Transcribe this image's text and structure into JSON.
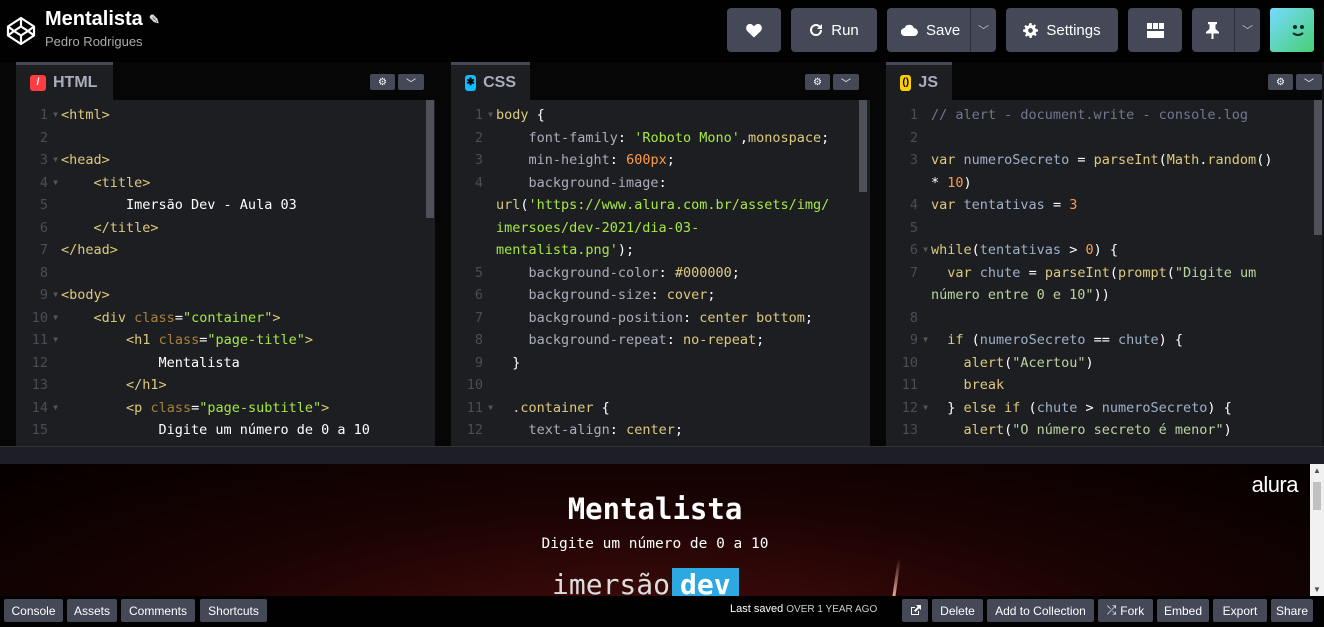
{
  "header": {
    "pen_title": "Mentalista",
    "author": "Pedro Rodrigues",
    "buttons": {
      "love": "",
      "run": "Run",
      "save": "Save",
      "settings": "Settings"
    }
  },
  "panes": {
    "html": {
      "label": "HTML",
      "icon_color": "#ff3c41",
      "lines": [
        {
          "n": "1",
          "fold": true,
          "html": "<span class='t'>&lt;html&gt;</span>"
        },
        {
          "n": "2",
          "fold": false,
          "html": ""
        },
        {
          "n": "3",
          "fold": true,
          "html": "<span class='t'>&lt;head&gt;</span>"
        },
        {
          "n": "4",
          "fold": true,
          "html": "    <span class='t'>&lt;title&gt;</span>"
        },
        {
          "n": "5",
          "fold": false,
          "html": "        Imersão Dev - Aula 03"
        },
        {
          "n": "6",
          "fold": false,
          "html": "    <span class='t'>&lt;/title&gt;</span>"
        },
        {
          "n": "7",
          "fold": false,
          "html": "<span class='t'>&lt;/head&gt;</span>"
        },
        {
          "n": "8",
          "fold": false,
          "html": ""
        },
        {
          "n": "9",
          "fold": true,
          "html": "<span class='t'>&lt;body&gt;</span>"
        },
        {
          "n": "10",
          "fold": true,
          "html": "    <span class='t'>&lt;div</span> <span class='a'>class</span>=<span class='str2'>\"container\"</span><span class='t'>&gt;</span>"
        },
        {
          "n": "11",
          "fold": true,
          "html": "        <span class='t'>&lt;h1</span> <span class='a'>class</span>=<span class='str2'>\"page-title\"</span><span class='t'>&gt;</span>"
        },
        {
          "n": "12",
          "fold": false,
          "html": "            Mentalista"
        },
        {
          "n": "13",
          "fold": false,
          "html": "        <span class='t'>&lt;/h1&gt;</span>"
        },
        {
          "n": "14",
          "fold": true,
          "html": "        <span class='t'>&lt;p</span> <span class='a'>class</span>=<span class='str2'>\"page-subtitle\"</span><span class='t'>&gt;</span>"
        },
        {
          "n": "15",
          "fold": false,
          "html": "            Digite um número de 0 a 10"
        }
      ]
    },
    "css": {
      "label": "CSS",
      "icon_color": "#0ebeff",
      "lines": [
        {
          "n": "1",
          "fold": true,
          "html": "<span class='t'>body</span> {"
        },
        {
          "n": "2",
          "fold": false,
          "html": "    <span class='pr'>font-family</span>: <span class='str2'>'Roboto Mono'</span>,<span class='t'>monospace</span>;"
        },
        {
          "n": "3",
          "fold": false,
          "html": "    <span class='pr'>min-height</span>: <span class='hn'>600px</span>;"
        },
        {
          "n": "4",
          "fold": false,
          "html": "    <span class='pr'>background-image</span>:"
        },
        {
          "n": "",
          "fold": false,
          "html": "<span class='t'>url</span>(<span class='str2'>'https://www.alura.com.br/assets/img/</span>"
        },
        {
          "n": "",
          "fold": false,
          "html": "<span class='str2'>imersoes/dev-2021/dia-03-</span>"
        },
        {
          "n": "",
          "fold": false,
          "html": "<span class='str2'>mentalista.png'</span>);"
        },
        {
          "n": "5",
          "fold": false,
          "html": "    <span class='pr'>background-color</span>: <span class='t'>#000000</span>;"
        },
        {
          "n": "6",
          "fold": false,
          "html": "    <span class='pr'>background-size</span>: <span class='t'>cover</span>;"
        },
        {
          "n": "7",
          "fold": false,
          "html": "    <span class='pr'>background-position</span>: <span class='t'>center bottom</span>;"
        },
        {
          "n": "8",
          "fold": false,
          "html": "    <span class='pr'>background-repeat</span>: <span class='t'>no-repeat</span>;"
        },
        {
          "n": "9",
          "fold": false,
          "html": "  }"
        },
        {
          "n": "10",
          "fold": false,
          "html": ""
        },
        {
          "n": "11",
          "fold": true,
          "html": "  <span class='t'>.container</span> {"
        },
        {
          "n": "12",
          "fold": false,
          "html": "    <span class='pr'>text-align</span>: <span class='t'>center</span>;"
        }
      ]
    },
    "js": {
      "label": "JS",
      "icon_color": "#fcd000",
      "lines": [
        {
          "n": "1",
          "fold": false,
          "html": "<span class='c'>// alert - document.write - console.log</span>"
        },
        {
          "n": "2",
          "fold": false,
          "html": ""
        },
        {
          "n": "3",
          "fold": false,
          "html": "<span class='k'>var</span> <span class='vn'>numeroSecreto</span> = <span class='f'>parseInt</span>(<span class='t'>Math</span>.<span class='f'>random</span>()"
        },
        {
          "n": "",
          "fold": false,
          "html": "* <span class='hn'>10</span>)"
        },
        {
          "n": "4",
          "fold": false,
          "html": "<span class='k'>var</span> <span class='vn'>tentativas</span> = <span class='hn'>3</span>"
        },
        {
          "n": "5",
          "fold": false,
          "html": ""
        },
        {
          "n": "6",
          "fold": true,
          "html": "<span class='k'>while</span>(<span class='vn'>tentativas</span> &gt; <span class='hn'>0</span>) {"
        },
        {
          "n": "7",
          "fold": false,
          "html": "  <span class='k'>var</span> <span class='vn'>chute</span> = <span class='f'>parseInt</span>(<span class='f'>prompt</span>(<span class='green'>\"Digite um</span>"
        },
        {
          "n": "",
          "fold": false,
          "html": "<span class='green'>número entre 0 e 10\"</span>))"
        },
        {
          "n": "8",
          "fold": false,
          "html": ""
        },
        {
          "n": "9",
          "fold": true,
          "html": "  <span class='k'>if</span> (<span class='vn'>numeroSecreto</span> == <span class='vn'>chute</span>) {"
        },
        {
          "n": "10",
          "fold": false,
          "html": "    <span class='f'>alert</span>(<span class='green'>\"Acertou\"</span>)"
        },
        {
          "n": "11",
          "fold": false,
          "html": "    <span class='k'>break</span>"
        },
        {
          "n": "12",
          "fold": true,
          "html": "  } <span class='k'>else if</span> (<span class='vn'>chute</span> &gt; <span class='vn'>numeroSecreto</span>) {"
        },
        {
          "n": "13",
          "fold": false,
          "html": "    <span class='f'>alert</span>(<span class='green'>\"O número secreto é menor\"</span>)"
        }
      ]
    }
  },
  "preview": {
    "brand": "alura",
    "title": "Mentalista",
    "subtitle": "Digite um número de 0 a 10",
    "logo_word": "imersão",
    "logo_badge": "dev"
  },
  "footer": {
    "console": "Console",
    "assets": "Assets",
    "comments": "Comments",
    "shortcuts": "Shortcuts",
    "last_saved_label": "Last saved",
    "last_saved_value": "OVER 1 YEAR AGO",
    "delete": "Delete",
    "add_to_collection": "Add to Collection",
    "fork": "Fork",
    "embed": "Embed",
    "export": "Export",
    "share": "Share"
  }
}
